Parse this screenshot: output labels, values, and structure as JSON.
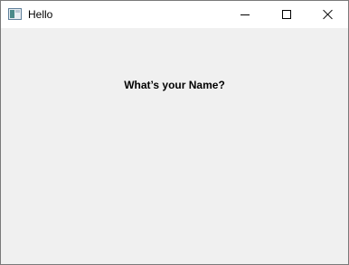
{
  "window": {
    "title": "Hello",
    "icon": "app-window-icon",
    "controls": {
      "minimize_icon": "minimize-icon",
      "maximize_icon": "maximize-icon",
      "close_icon": "close-icon"
    }
  },
  "content": {
    "prompt": "What’s your Name?"
  }
}
